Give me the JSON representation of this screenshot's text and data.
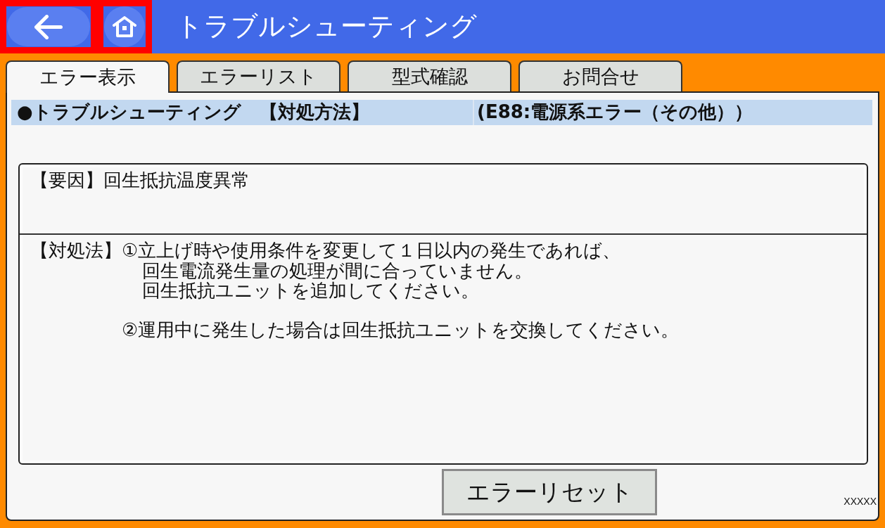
{
  "nav": [
    {
      "kind": "back",
      "highlighted": true
    },
    {
      "kind": "home",
      "highlighted": true
    }
  ],
  "title": "トラブルシューティング",
  "tabs": [
    {
      "label": "エラー表示",
      "selected": true
    },
    {
      "label": "エラーリスト",
      "selected": false
    },
    {
      "label": "型式確認",
      "selected": false
    },
    {
      "label": "お問合せ",
      "selected": false
    }
  ],
  "header": {
    "section": "●トラブルシューティング　【対処方法】",
    "error": "(E88:電源系エラー（その他））"
  },
  "cause": {
    "text": "【要因】回生抵抗温度異常"
  },
  "remedy": {
    "label": "【対処法】",
    "items": [
      {
        "lines": [
          "①立上げ時や使用条件を変更して１日以内の発生であれば、",
          "回生電流発生量の処理が間に合っていません。",
          "回生抵抗ユニットを追加してください。"
        ]
      },
      {
        "lines": [
          "②運用中に発生した場合は回生抵抗ユニットを交換してください。"
        ]
      }
    ]
  },
  "reset_button": "エラーリセット",
  "footer_code": "XXXXX"
}
